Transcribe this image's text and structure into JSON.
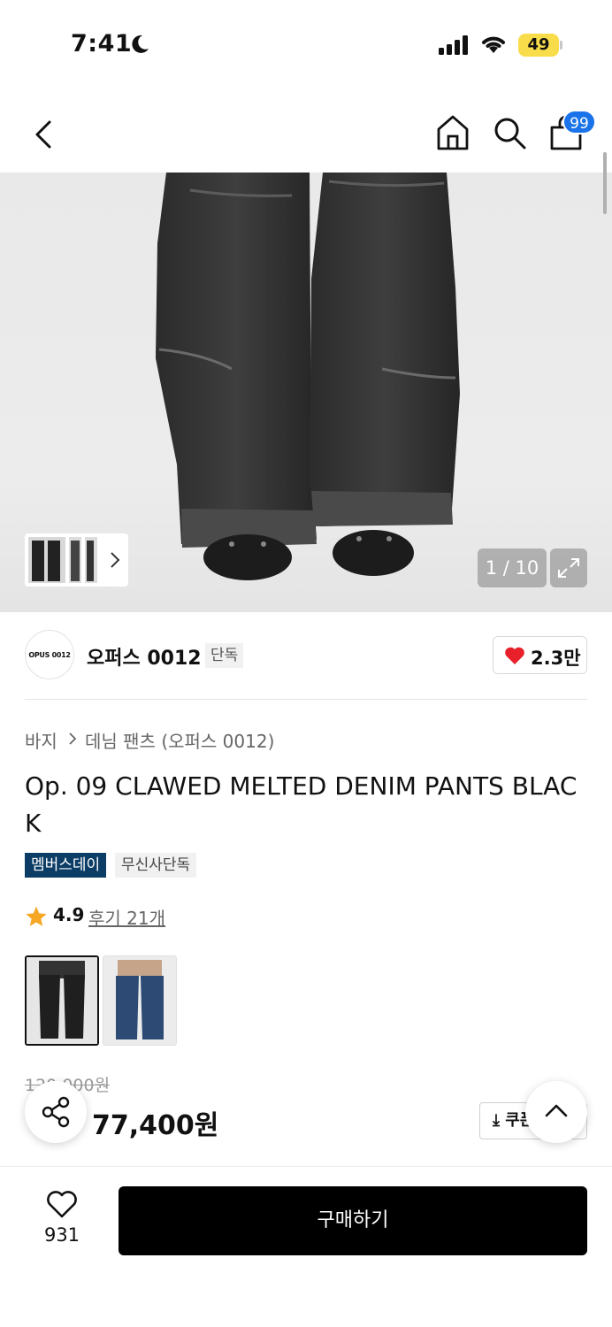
{
  "status_bar": {
    "time": "7:41",
    "battery": "49"
  },
  "nav": {
    "cart_badge": "99"
  },
  "gallery": {
    "counter": "1 / 10"
  },
  "brand": {
    "logo_text": "OPUS 0012",
    "name": "오퍼스 0012",
    "tag": "단독",
    "likes": "2.3만"
  },
  "breadcrumb": {
    "category": "바지",
    "subcategory": "데님 팬츠 (오퍼스 0012)"
  },
  "product": {
    "title": "Op. 09 CLAWED MELTED DENIM PANTS BLACK",
    "tags": [
      "멤버스데이",
      "무신사단독"
    ],
    "rating": "4.9",
    "reviews": "후기 21개",
    "original_price": "120,000원",
    "sale_price": "77,400원",
    "coupon_label": "쿠폰"
  },
  "bottom_bar": {
    "wish_count": "931",
    "buy_label": "구매하기"
  },
  "colors": {
    "accent": "#0b3d66",
    "badge_blue": "#1a73e8",
    "heart": "#e8202a",
    "star": "#f5a623"
  }
}
